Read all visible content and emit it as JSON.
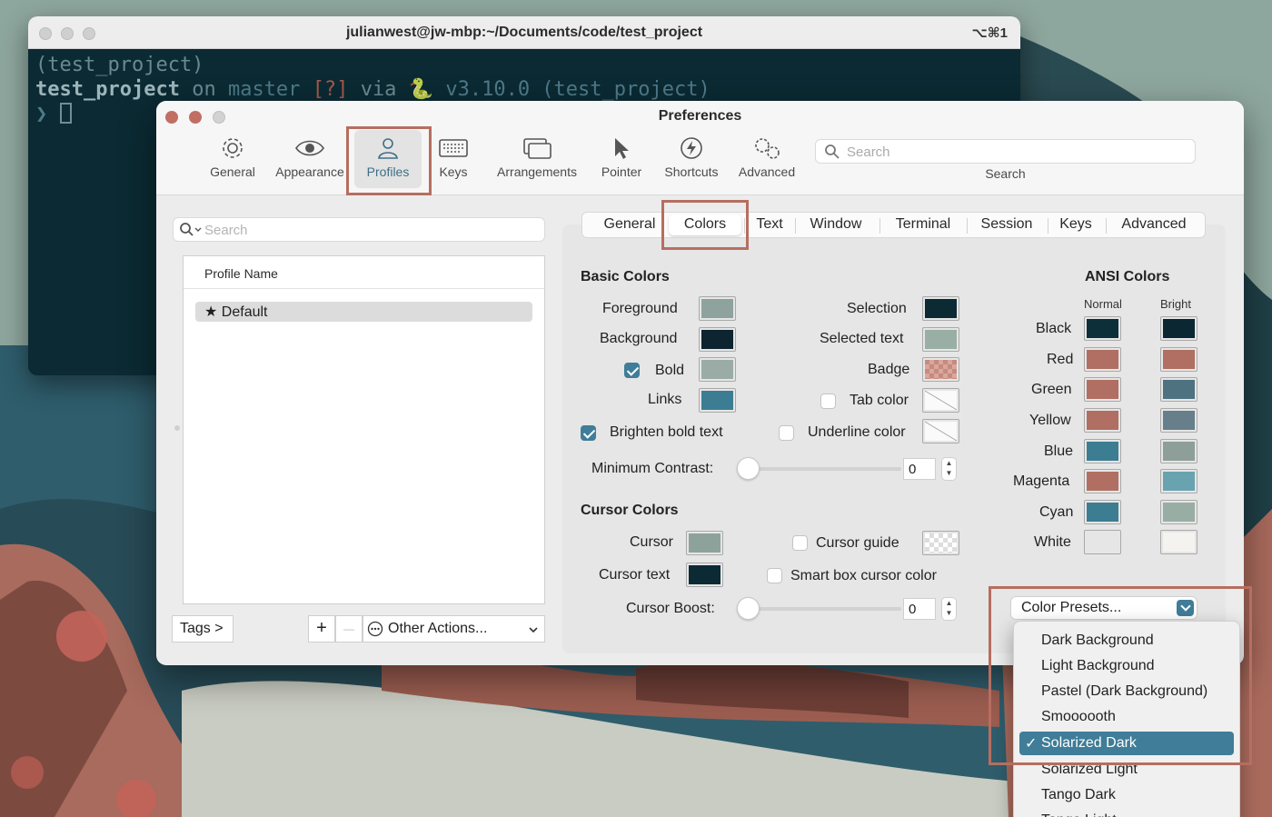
{
  "terminal": {
    "title": "julianwest@jw-mbp:~/Documents/code/test_project",
    "shortcut": "⌥⌘1",
    "line1": "(test_project)",
    "line2_dir": "test_project",
    "line2_on": "on",
    "line2_branch_icon": "",
    "line2_branch": "master",
    "line2_status": "[?]",
    "line2_via": "via",
    "line2_python": "v3.10.0 (test_project)",
    "prompt": "❯"
  },
  "prefs": {
    "title": "Preferences",
    "toolbar": [
      {
        "label": "General",
        "icon": "gear-icon"
      },
      {
        "label": "Appearance",
        "icon": "eye-icon"
      },
      {
        "label": "Profiles",
        "icon": "person-icon"
      },
      {
        "label": "Keys",
        "icon": "keyboard-icon"
      },
      {
        "label": "Arrangements",
        "icon": "windows-icon"
      },
      {
        "label": "Pointer",
        "icon": "pointer-icon"
      },
      {
        "label": "Shortcuts",
        "icon": "lightning-icon"
      },
      {
        "label": "Advanced",
        "icon": "gears-icon"
      }
    ],
    "search_placeholder": "Search",
    "search_label": "Search",
    "left": {
      "search_placeholder": "Search",
      "column_header": "Profile Name",
      "profiles": [
        "★ Default"
      ],
      "tags_button": "Tags >",
      "add_button": "+",
      "remove_button": "—",
      "other_actions": "Other Actions..."
    },
    "tabs": [
      "General",
      "Colors",
      "Text",
      "Window",
      "Terminal",
      "Session",
      "Keys",
      "Advanced"
    ],
    "basic_colors": {
      "title": "Basic Colors",
      "foreground": "Foreground",
      "background": "Background",
      "bold": "Bold",
      "links": "Links",
      "selection": "Selection",
      "selected_text": "Selected text",
      "badge": "Badge",
      "tab_color": "Tab color",
      "brighten_bold": "Brighten bold text",
      "underline_color": "Underline color",
      "min_contrast": "Minimum Contrast:",
      "min_contrast_value": "0"
    },
    "cursor_colors": {
      "title": "Cursor Colors",
      "cursor": "Cursor",
      "cursor_text": "Cursor text",
      "cursor_guide": "Cursor guide",
      "smart_box": "Smart box cursor color",
      "cursor_boost": "Cursor Boost:",
      "cursor_boost_value": "0"
    },
    "ansi": {
      "title": "ANSI Colors",
      "normal": "Normal",
      "bright": "Bright",
      "rows": [
        {
          "name": "Black",
          "normal": "#0d2f3a",
          "bright": "#0b2731"
        },
        {
          "name": "Red",
          "normal": "#b06f62",
          "bright": "#b06f62"
        },
        {
          "name": "Green",
          "normal": "#b06f62",
          "bright": "#4f7281"
        },
        {
          "name": "Yellow",
          "normal": "#b06f62",
          "bright": "#667f8a"
        },
        {
          "name": "Blue",
          "normal": "#3d7d92",
          "bright": "#8e9f99"
        },
        {
          "name": "Magenta",
          "normal": "#b06f62",
          "bright": "#6aa3b0"
        },
        {
          "name": "Cyan",
          "normal": "#3d7d92",
          "bright": "#98aea5"
        },
        {
          "name": "White",
          "normal": "#e6e6e6",
          "bright": "#f5f3ef"
        }
      ]
    },
    "presets_button": "Color Presets...",
    "presets_menu": [
      "Dark Background",
      "Light Background",
      "Pastel (Dark Background)",
      "Smoooooth",
      "Solarized Dark",
      "Solarized Light",
      "Tango Dark",
      "Tango Light"
    ],
    "presets_selected": "Solarized Dark"
  },
  "colors": {
    "accent": "#3f7d98",
    "highlight_box": "#b66e60",
    "foreground_swatch": "#8fa39e",
    "background_swatch": "#0c2530",
    "bold_swatch": "#9aaca5",
    "links_swatch": "#3c7d93",
    "selection_swatch": "#0c2a34",
    "selected_text_swatch": "#99aea4",
    "cursor_swatch": "#8ea29c",
    "cursor_text_swatch": "#0c2a34"
  }
}
